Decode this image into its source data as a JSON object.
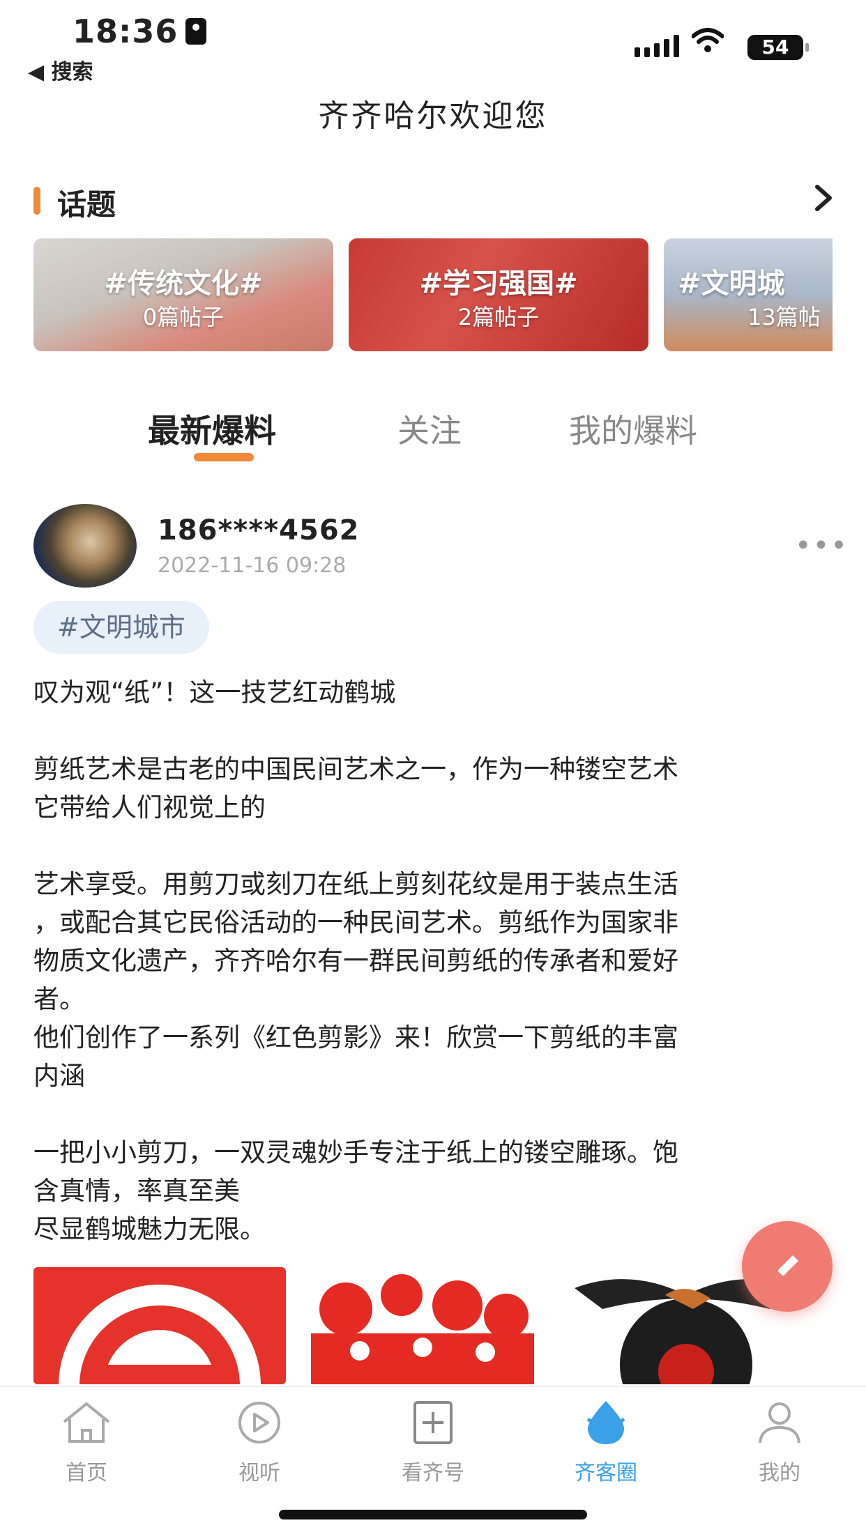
{
  "status_bar": {
    "time": "18:36",
    "back_label": "◀ 搜索",
    "battery": "54"
  },
  "header": {
    "title": "齐齐哈尔欢迎您"
  },
  "topics": {
    "label": "话题",
    "items": [
      {
        "name": "#传统文化#",
        "count": "0篇帖子"
      },
      {
        "name": "#学习强国#",
        "count": "2篇帖子"
      },
      {
        "name": "#文明城",
        "count": "13篇帖"
      }
    ]
  },
  "tabs": [
    {
      "label": "最新爆料",
      "active": true
    },
    {
      "label": "关注",
      "active": false
    },
    {
      "label": "我的爆料",
      "active": false
    }
  ],
  "post": {
    "user": "186****4562",
    "time": "2022-11-16 09:28",
    "tag": "#文明城市",
    "paragraphs": [
      "叹为观“纸”！这一技艺红动鹤城",
      "",
      "剪纸艺术是古老的中国民间艺术之一，作为一种镂空艺术",
      "它带给人们视觉上的",
      "",
      "艺术享受。用剪刀或刻刀在纸上剪刻花纹是用于装点生活",
      "，或配合其它民俗活动的一种民间艺术。剪纸作为国家非",
      "物质文化遗产，齐齐哈尔有一群民间剪纸的传承者和爱好",
      "者。",
      "他们创作了一系列《红色剪影》来！欣赏一下剪纸的丰富",
      "内涵",
      "",
      "一把小小剪刀，一双灵魂妙手专注于纸上的镂空雕琢。饱",
      "含真情，率真至美",
      "尽显鹤城魅力无限。"
    ]
  },
  "bottom_nav": [
    {
      "label": "首页",
      "icon": "home-icon",
      "active": false
    },
    {
      "label": "视听",
      "icon": "play-icon",
      "active": false
    },
    {
      "label": "看齐号",
      "icon": "add-box-icon",
      "active": false
    },
    {
      "label": "齐客圈",
      "icon": "droplet-icon",
      "active": true
    },
    {
      "label": "我的",
      "icon": "user-icon",
      "active": false
    }
  ],
  "colors": {
    "accent": "#f08a3a",
    "nav_active": "#3aa0e8",
    "fab": "#f07b73",
    "tag_bg": "#e8f0fa"
  }
}
